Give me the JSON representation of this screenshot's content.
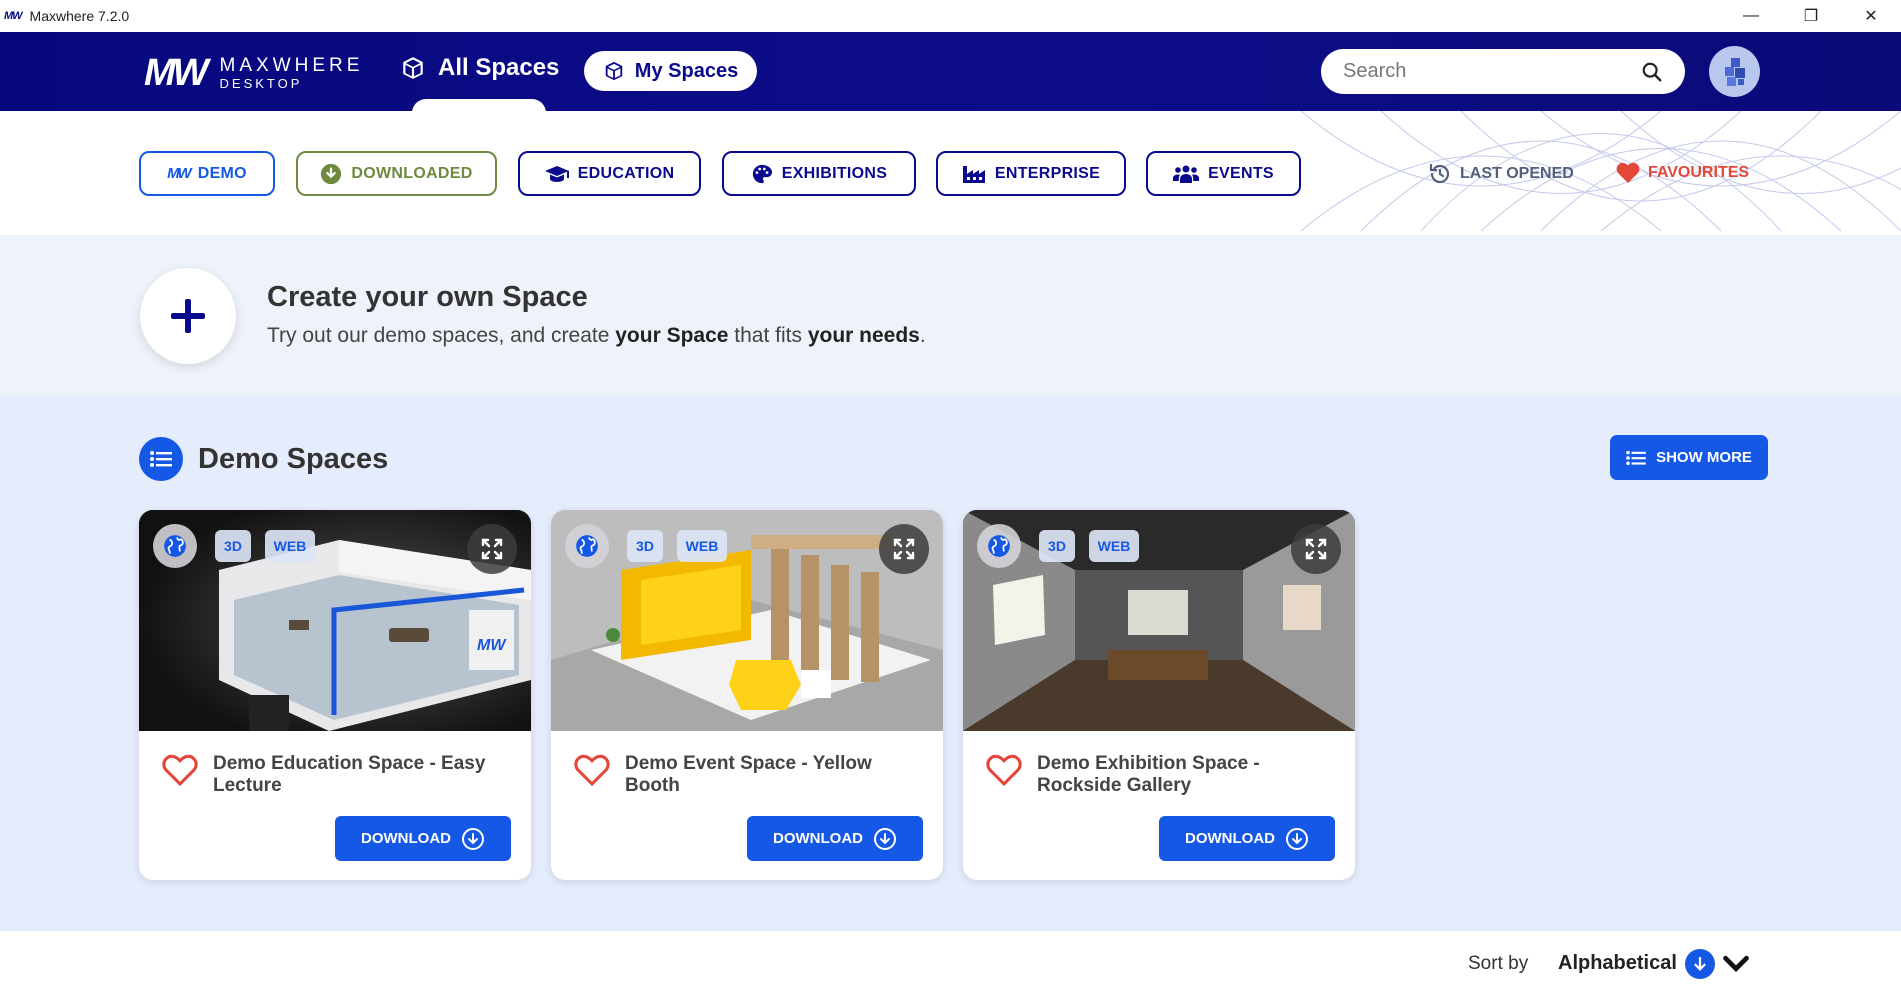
{
  "window": {
    "title": "Maxwhere 7.2.0",
    "logo_mark": "MW",
    "minimize": "—",
    "maximize": "❐",
    "close": "✕"
  },
  "header": {
    "logo_mark": "MW",
    "logo_line1": "MAXWHERE",
    "logo_line2": "DESKTOP",
    "tab_all": "All Spaces",
    "tab_my": "My Spaces",
    "search_placeholder": "Search"
  },
  "filters": [
    {
      "label": "DEMO",
      "icon": "mw-icon"
    },
    {
      "label": "DOWNLOADED",
      "icon": "download-circle-icon"
    },
    {
      "label": "EDUCATION",
      "icon": "graduation-cap-icon"
    },
    {
      "label": "EXHIBITIONS",
      "icon": "palette-icon"
    },
    {
      "label": "ENTERPRISE",
      "icon": "factory-icon"
    },
    {
      "label": "EVENTS",
      "icon": "people-icon"
    }
  ],
  "quick_links": {
    "last_opened": "LAST OPENED",
    "favourites": "FAVOURITES"
  },
  "colors": {
    "navy": "#0a0a8c",
    "accent": "#1558e6",
    "downloaded": "#6e8a3f",
    "favourite": "#e4473a",
    "last_opened": "#52607a"
  },
  "create": {
    "title": "Create your own Space",
    "text_1": "Try out our demo spaces, and create ",
    "bold_1": "your Space",
    "text_2": " that fits ",
    "bold_2": "your needs",
    "text_3": "."
  },
  "demo_section": {
    "title": "Demo Spaces",
    "show_more": "SHOW MORE",
    "cards": [
      {
        "title": "Demo Education Space - Easy Lecture",
        "badge_3d": "3D",
        "badge_web": "WEB",
        "download": "DOWNLOAD"
      },
      {
        "title": "Demo Event Space - Yellow Booth",
        "badge_3d": "3D",
        "badge_web": "WEB",
        "download": "DOWNLOAD"
      },
      {
        "title": "Demo Exhibition Space - Rockside Gallery",
        "badge_3d": "3D",
        "badge_web": "WEB",
        "download": "DOWNLOAD"
      }
    ]
  },
  "sort": {
    "label": "Sort by",
    "value": "Alphabetical"
  }
}
